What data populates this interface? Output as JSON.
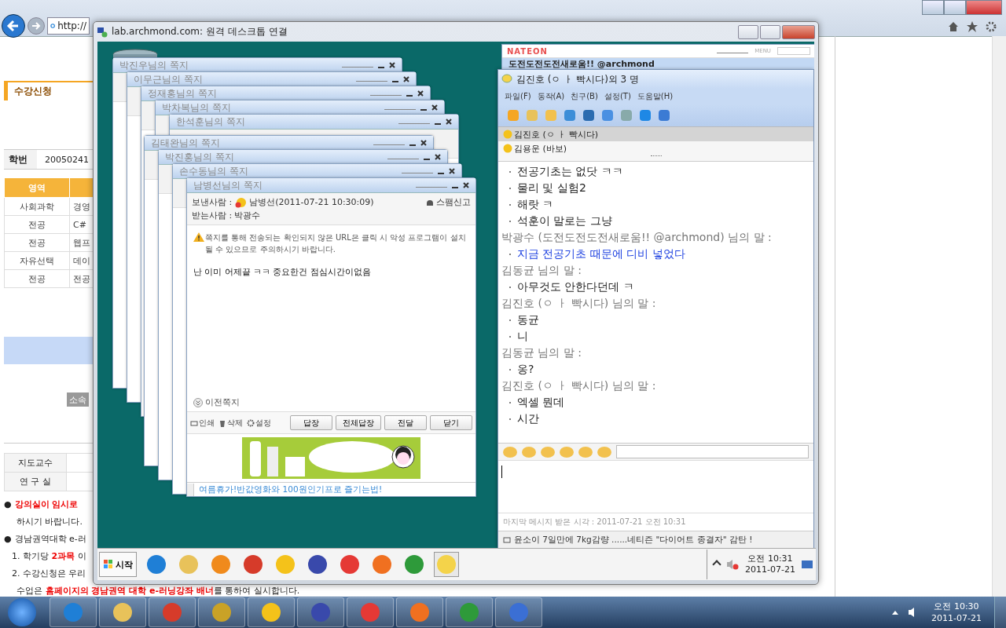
{
  "browser": {
    "address": "http://",
    "page": {
      "heading": "수강신청",
      "student_id_label": "학번",
      "student_id": "20050241",
      "table": {
        "columns": [
          "영역"
        ],
        "rows": [
          [
            "사회과학",
            "경영"
          ],
          [
            "전공",
            "C#"
          ],
          [
            "전공",
            "웹프"
          ],
          [
            "자유선택",
            "데이"
          ],
          [
            "전공",
            "전공"
          ]
        ]
      },
      "button": "소속",
      "advisor": [
        "지도교수",
        "연 구 실"
      ],
      "notices": [
        {
          "marker": "●",
          "indented": false,
          "parts": [
            {
              "text": "강의실이 임시로",
              "emphasis": true
            }
          ]
        },
        {
          "indented": true,
          "parts": [
            {
              "text": "하시기 바랍니다.",
              "emphasis": false
            }
          ]
        },
        {
          "marker": "●",
          "indented": false,
          "parts": [
            {
              "text": "경남권역대학 e-러",
              "emphasis": false
            }
          ]
        },
        {
          "indented": false,
          "parts": [
            {
              "text": "1. 학기당 ",
              "emphasis": false
            },
            {
              "text": "2과목",
              "emphasis": true
            },
            {
              "text": " 이",
              "emphasis": false
            }
          ]
        },
        {
          "indented": false,
          "parts": [
            {
              "text": "2. 수강신청은 우리",
              "emphasis": false
            }
          ]
        },
        {
          "indented": true,
          "parts": [
            {
              "text": "수업은 ",
              "emphasis": false
            },
            {
              "text": "홈페이지의 경남권역 대학 e-러닝강좌 배너",
              "emphasis": true
            },
            {
              "text": "를 통하여 실시합니다.",
              "emphasis": false
            }
          ]
        }
      ]
    }
  },
  "remote": {
    "title": "lab.archmond.com: 원격 데스크톱 연결",
    "background_notes": [
      {
        "title": "박진우님의 쪽지"
      },
      {
        "title": "이무근님의 쪽지"
      },
      {
        "title": "정재홍님의 쪽지"
      },
      {
        "title": "박차복님의 쪽지"
      },
      {
        "title": "한석훈님의 쪽지"
      },
      {
        "title": "김태완님의 쪽지"
      },
      {
        "title": "박진홍님의 쪽지"
      },
      {
        "title": "손수동님의 쪽지"
      }
    ],
    "note": {
      "title": "남병선님의 쪽지",
      "sender_label": "보낸사람 :",
      "sender": "남병선(2011-07-21 10:30:09)",
      "spam": "스팸신고",
      "receiver_label": "받는사람 :",
      "receiver": "박광수",
      "warning": "쪽지를 통해 전송되는 확인되지 않은 URL은 클릭 시 악성 프로그램이 설치될 수 있으므로 주의하시기 바랍니다.",
      "message": "난 이미 어제끝 ㅋㅋ 중요한건 점심시간이없음",
      "previous": "이전쪽지",
      "tools": [
        {
          "kind": "print",
          "label": "인쇄"
        },
        {
          "kind": "delete",
          "label": "삭제"
        },
        {
          "kind": "settings",
          "label": "설정"
        }
      ],
      "buttons": [
        "답장",
        "전체답장",
        "전달",
        "닫기"
      ],
      "ticker": "여름휴가!반값영화와 100원인기프로 즐기는법!"
    },
    "messenger": {
      "logo": "NATEON",
      "menu": "MENU",
      "status": "도전도전도전새로움!! @archmond"
    },
    "chat": {
      "title": "김진호 (ㅇ ㅏ 빡시다)외 3 명",
      "menu": [
        "파일(F)",
        "동작(A)",
        "친구(B)",
        "설정(T)",
        "도움말(H)"
      ],
      "participants": [
        {
          "name": "김진호 (ㅇ ㅏ 빡시다)",
          "selected": true
        },
        {
          "name": "김용운 (바보)",
          "selected": false
        }
      ],
      "messages": [
        {
          "kind": "line",
          "text": "전공기초는 없닷 ㅋㅋ",
          "self": false
        },
        {
          "kind": "line",
          "text": "물리 및 실험2",
          "self": false
        },
        {
          "kind": "line",
          "text": "해랏 ㅋ",
          "self": false
        },
        {
          "kind": "line",
          "text": "석훈이 말로는 그냥",
          "self": false
        },
        {
          "kind": "speaker",
          "text": "박광수 (도전도전도전새로움!! @archmond) 님의 말 :"
        },
        {
          "kind": "line",
          "text": "지금 전공기초 때문에 디비 넣었다",
          "self": true
        },
        {
          "kind": "speaker",
          "text": "김동균 님의 말 :"
        },
        {
          "kind": "line",
          "text": "아무것도 안한다던데 ㅋ",
          "self": false
        },
        {
          "kind": "speaker",
          "text": "김진호 (ㅇ ㅏ 빡시다) 님의 말 :"
        },
        {
          "kind": "line",
          "text": "동균",
          "self": false
        },
        {
          "kind": "line",
          "text": "니",
          "self": false
        },
        {
          "kind": "speaker",
          "text": "김동균 님의 말 :"
        },
        {
          "kind": "line",
          "text": "옹?",
          "self": false
        },
        {
          "kind": "speaker",
          "text": "김진호 (ㅇ ㅏ 빡시다) 님의 말 :"
        },
        {
          "kind": "line",
          "text": "엑셀 뭔데",
          "self": false
        },
        {
          "kind": "line",
          "text": "시간",
          "self": false
        }
      ],
      "last_received": "마지막 메시지 받은 시각 : 2011-07-21 오전 10:31",
      "news": "윤소이 7일만에 7kg감량 ......네티즌 \"다이어트 종결자\" 감탄 !"
    },
    "taskbar": {
      "start": "시작",
      "time": "오전 10:31",
      "date": "2011-07-21"
    }
  },
  "taskbar": {
    "time": "오전 10:30",
    "date": "2011-07-21"
  }
}
